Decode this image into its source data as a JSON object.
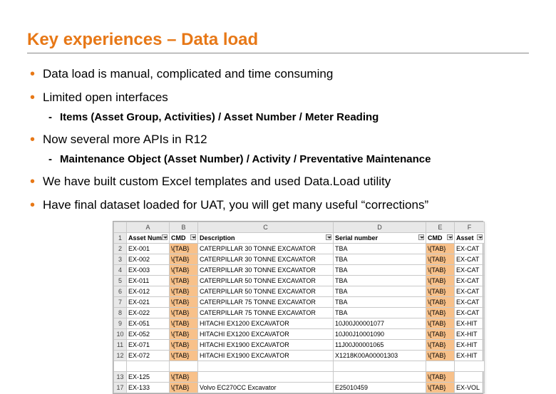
{
  "title": "Key experiences – Data load",
  "bullets": {
    "b1": "Data load is manual, complicated and time consuming",
    "b2": "Limited open interfaces",
    "b2_sub1": "Items (Asset Group, Activities) / Asset Number / Meter Reading",
    "b3": "Now several more APIs in R12",
    "b3_sub1": "Maintenance Object (Asset Number) / Activity / Preventative Maintenance",
    "b4": "We have built custom Excel templates and used Data.Load utility",
    "b5": "Have final dataset loaded for UAT, you will get many useful “corrections”"
  },
  "sheet": {
    "colLetters": [
      "A",
      "B",
      "C",
      "D",
      "E",
      "F"
    ],
    "headers": {
      "a": "Asset Num",
      "b": "CMD",
      "c": "Description",
      "d": "Serial number",
      "e": "CMD",
      "f": "Asset"
    },
    "rows": [
      {
        "n": "1",
        "hdr": true
      },
      {
        "n": "2",
        "a": "EX-001",
        "b": "\\{TAB}",
        "c": "CATERPILLAR 30 TONNE EXCAVATOR",
        "d": "TBA",
        "e": "\\{TAB}",
        "f": "EX-CAT"
      },
      {
        "n": "3",
        "a": "EX-002",
        "b": "\\{TAB}",
        "c": "CATERPILLAR 30 TONNE EXCAVATOR",
        "d": "TBA",
        "e": "\\{TAB}",
        "f": "EX-CAT"
      },
      {
        "n": "4",
        "a": "EX-003",
        "b": "\\{TAB}",
        "c": "CATERPILLAR 30 TONNE EXCAVATOR",
        "d": "TBA",
        "e": "\\{TAB}",
        "f": "EX-CAT"
      },
      {
        "n": "5",
        "a": "EX-011",
        "b": "\\{TAB}",
        "c": "CATERPILLAR 50 TONNE EXCAVATOR",
        "d": "TBA",
        "e": "\\{TAB}",
        "f": "EX-CAT"
      },
      {
        "n": "6",
        "a": "EX-012",
        "b": "\\{TAB}",
        "c": "CATERPILLAR 50 TONNE EXCAVATOR",
        "d": "TBA",
        "e": "\\{TAB}",
        "f": "EX-CAT"
      },
      {
        "n": "7",
        "a": "EX-021",
        "b": "\\{TAB}",
        "c": "CATERPILLAR 75 TONNE EXCAVATOR",
        "d": "TBA",
        "e": "\\{TAB}",
        "f": "EX-CAT"
      },
      {
        "n": "8",
        "a": "EX-022",
        "b": "\\{TAB}",
        "c": "CATERPILLAR 75 TONNE EXCAVATOR",
        "d": "TBA",
        "e": "\\{TAB}",
        "f": "EX-CAT"
      },
      {
        "n": "9",
        "a": "EX-051",
        "b": "\\{TAB}",
        "c": "HITACHI EX1200 EXCAVATOR",
        "d": "10J00J00001077",
        "e": "\\{TAB}",
        "f": "EX-HIT"
      },
      {
        "n": "10",
        "a": "EX-052",
        "b": "\\{TAB}",
        "c": "HITACHI EX1200 EXCAVATOR",
        "d": "10J00J10001090",
        "e": "\\{TAB}",
        "f": "EX-HIT"
      },
      {
        "n": "11",
        "a": "EX-071",
        "b": "\\{TAB}",
        "c": "HITACHI EX1900 EXCAVATOR",
        "d": "11J00J00001065",
        "e": "\\{TAB}",
        "f": "EX-HIT"
      },
      {
        "n": "12",
        "a": "EX-072",
        "b": "\\{TAB}",
        "c": "HITACHI EX1900 EXCAVATOR",
        "d": "X1218K00A00001303",
        "e": "\\{TAB}",
        "f": "EX-HIT"
      }
    ],
    "gapAfter": 12,
    "tailRows": [
      {
        "n": "13",
        "a": "EX-125",
        "b": "\\{TAB}",
        "c": "",
        "d": "",
        "e": "\\{TAB}",
        "f": ""
      },
      {
        "n": "17",
        "a": "EX-133",
        "b": "\\{TAB}",
        "c": "Volvo EC270CC Excavator",
        "d": "E25010459",
        "e": "\\{TAB}",
        "f": "EX-VOL"
      }
    ]
  }
}
